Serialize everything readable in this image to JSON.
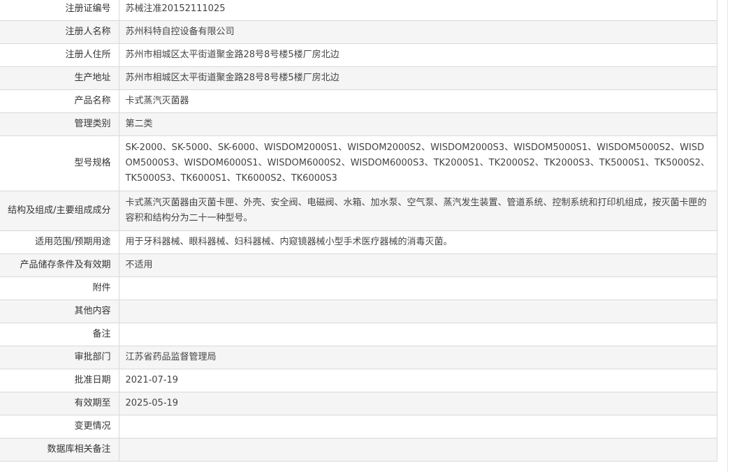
{
  "rows": [
    {
      "label": "注册证编号",
      "value": "苏械注准20152111025"
    },
    {
      "label": "注册人名称",
      "value": "苏州科特自控设备有限公司"
    },
    {
      "label": "注册人住所",
      "value": "苏州市相城区太平街道聚金路28号8号楼5楼厂房北边"
    },
    {
      "label": "生产地址",
      "value": "苏州市相城区太平街道聚金路28号8号楼5楼厂房北边"
    },
    {
      "label": "产品名称",
      "value": "卡式蒸汽灭菌器"
    },
    {
      "label": "管理类别",
      "value": "第二类"
    },
    {
      "label": "型号规格",
      "value": "SK-2000、SK-5000、SK-6000、WISDOM2000S1、WISDOM2000S2、WISDOM2000S3、WISDOM5000S1、WISDOM5000S2、WISDOM5000S3、WISDOM6000S1、WISDOM6000S2、WISDOM6000S3、TK2000S1、TK2000S2、TK2000S3、TK5000S1、TK5000S2、TK5000S3、TK6000S1、TK6000S2、TK6000S3"
    },
    {
      "label": "结构及组成/主要组成成分",
      "value": "卡式蒸汽灭菌器由灭菌卡匣、外壳、安全阀、电磁阀、水箱、加水泵、空气泵、蒸汽发生装置、管道系统、控制系统和打印机组成，按灭菌卡匣的容积和结构分为二十一种型号。"
    },
    {
      "label": "适用范围/预期用途",
      "value": "用于牙科器械、眼科器械、妇科器械、内窥镜器械小型手术医疗器械的消毒灭菌。"
    },
    {
      "label": "产品储存条件及有效期",
      "value": "不适用"
    },
    {
      "label": "附件",
      "value": ""
    },
    {
      "label": "其他内容",
      "value": ""
    },
    {
      "label": "备注",
      "value": ""
    },
    {
      "label": "审批部门",
      "value": "江苏省药品监督管理局"
    },
    {
      "label": "批准日期",
      "value": "2021-07-19"
    },
    {
      "label": "有效期至",
      "value": "2025-05-19"
    },
    {
      "label": "变更情况",
      "value": ""
    },
    {
      "label": "数据库相关备注",
      "value": ""
    }
  ]
}
